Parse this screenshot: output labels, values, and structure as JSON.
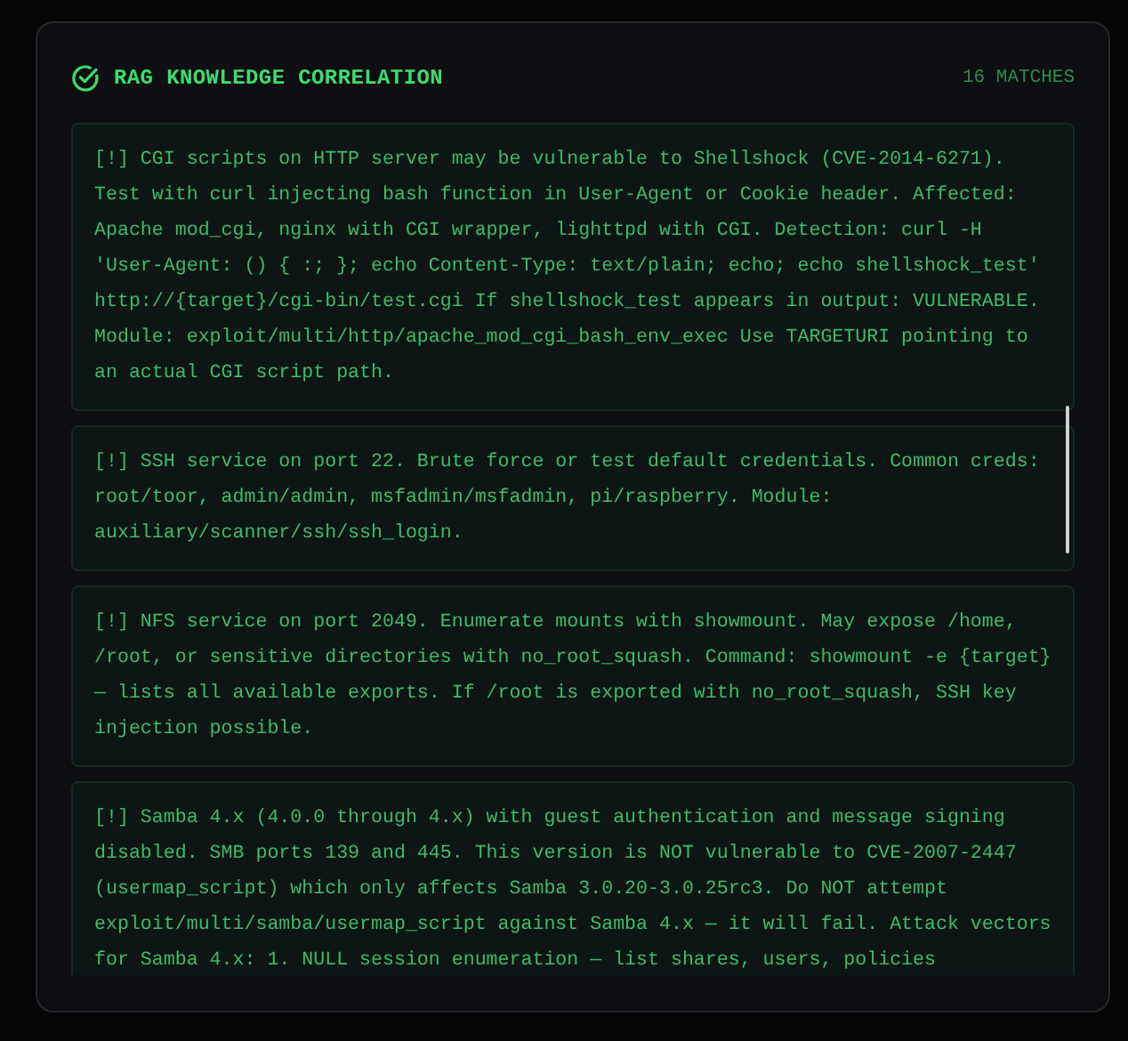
{
  "panel": {
    "title": "RAG KNOWLEDGE CORRELATION",
    "match_count": "16 MATCHES",
    "entries": [
      "[!] CGI scripts on HTTP server may be vulnerable to Shellshock (CVE-2014-6271). Test with curl injecting bash function in User-Agent or Cookie header. Affected: Apache mod_cgi, nginx with CGI wrapper, lighttpd with CGI. Detection: curl -H 'User-Agent: () { :; }; echo Content-Type: text/plain; echo; echo shellshock_test' http://{target}/cgi-bin/test.cgi If shellshock_test appears in output: VULNERABLE. Module: exploit/multi/http/apache_mod_cgi_bash_env_exec Use TARGETURI pointing to an actual CGI script path.",
      "[!] SSH service on port 22. Brute force or test default credentials. Common creds: root/toor, admin/admin, msfadmin/msfadmin, pi/raspberry. Module: auxiliary/scanner/ssh/ssh_login.",
      "[!] NFS service on port 2049. Enumerate mounts with showmount. May expose /home, /root, or sensitive directories with no_root_squash. Command: showmount -e {target} — lists all available exports. If /root is exported with no_root_squash, SSH key injection possible.",
      "[!] Samba 4.x (4.0.0 through 4.x) with guest authentication and message signing disabled. SMB ports 139 and 445. This version is NOT vulnerable to CVE-2007-2447 (usermap_script) which only affects Samba 3.0.20-3.0.25rc3. Do NOT attempt exploit/multi/samba/usermap_script against Samba 4.x — it will fail. Attack vectors for Samba 4.x: 1. NULL session enumeration — list shares, users, policies"
    ]
  }
}
